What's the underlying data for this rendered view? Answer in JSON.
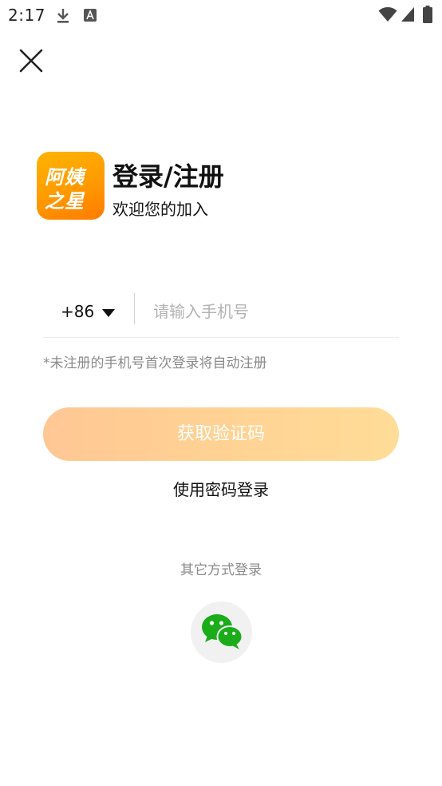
{
  "status_bar": {
    "time": "2:17",
    "icons": [
      "download-icon",
      "font-icon",
      "wifi-icon",
      "signal-icon",
      "battery-icon"
    ]
  },
  "logo": {
    "line1": "阿姨",
    "line2": "之星",
    "gradient_start": "#ffb400",
    "gradient_end": "#ff7a00"
  },
  "header": {
    "title": "登录/注册",
    "subtitle": "欢迎您的加入"
  },
  "phone": {
    "country_code": "+86",
    "placeholder": "请输入手机号",
    "value": ""
  },
  "hint": "*未注册的手机号首次登录将自动注册",
  "actions": {
    "get_code_label": "获取验证码",
    "password_login_label": "使用密码登录"
  },
  "other_login": {
    "title": "其它方式登录",
    "wechat_icon": "wechat-icon",
    "wechat_color": "#1aad19"
  },
  "colors": {
    "button_gradient_start": "#ffc794",
    "button_gradient_end": "#ffdc98",
    "hint": "#8a8a8a"
  }
}
